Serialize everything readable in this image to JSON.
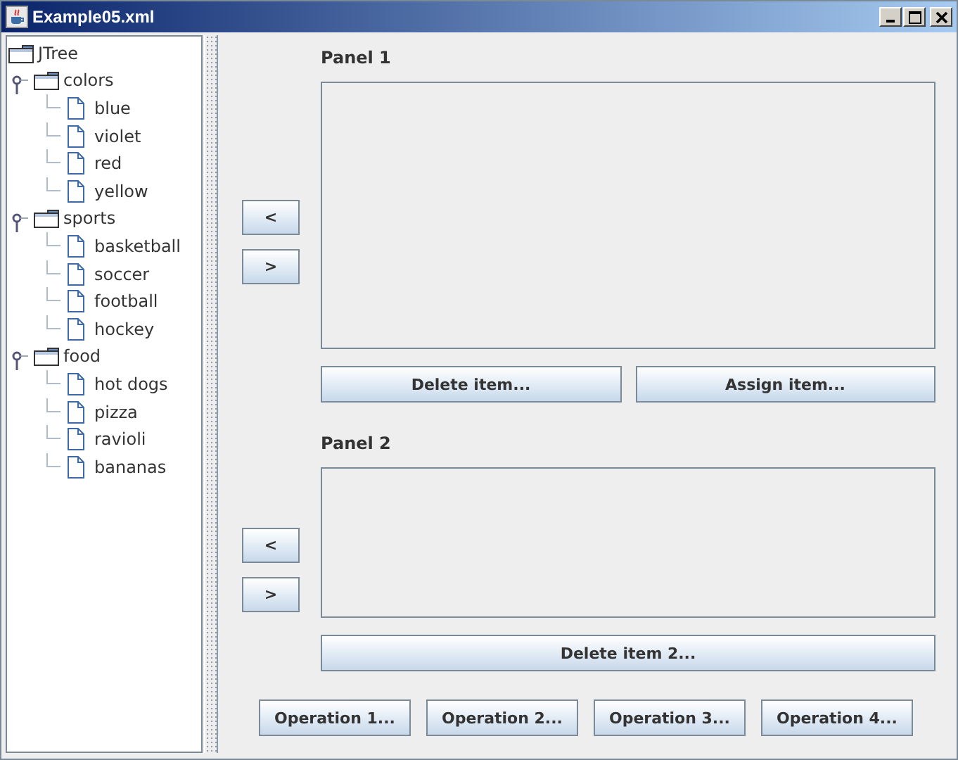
{
  "window": {
    "title": "Example05.xml"
  },
  "tree": {
    "label": "JTree",
    "children": [
      {
        "label": "colors",
        "expanded": true,
        "children": [
          {
            "label": "blue"
          },
          {
            "label": "violet"
          },
          {
            "label": "red"
          },
          {
            "label": "yellow"
          }
        ]
      },
      {
        "label": "sports",
        "expanded": true,
        "children": [
          {
            "label": "basketball"
          },
          {
            "label": "soccer"
          },
          {
            "label": "football"
          },
          {
            "label": "hockey"
          }
        ]
      },
      {
        "label": "food",
        "expanded": true,
        "children": [
          {
            "label": "hot dogs"
          },
          {
            "label": "pizza"
          },
          {
            "label": "ravioli"
          },
          {
            "label": "bananas"
          }
        ]
      }
    ]
  },
  "panels": [
    {
      "title": "Panel 1",
      "move_left": "<",
      "move_right": ">",
      "buttons": [
        "Delete item...",
        "Assign item..."
      ]
    },
    {
      "title": "Panel 2",
      "move_left": "<",
      "move_right": ">",
      "buttons": [
        "Delete item 2..."
      ]
    }
  ],
  "operations": [
    "Operation 1...",
    "Operation 2...",
    "Operation 3...",
    "Operation 4..."
  ]
}
